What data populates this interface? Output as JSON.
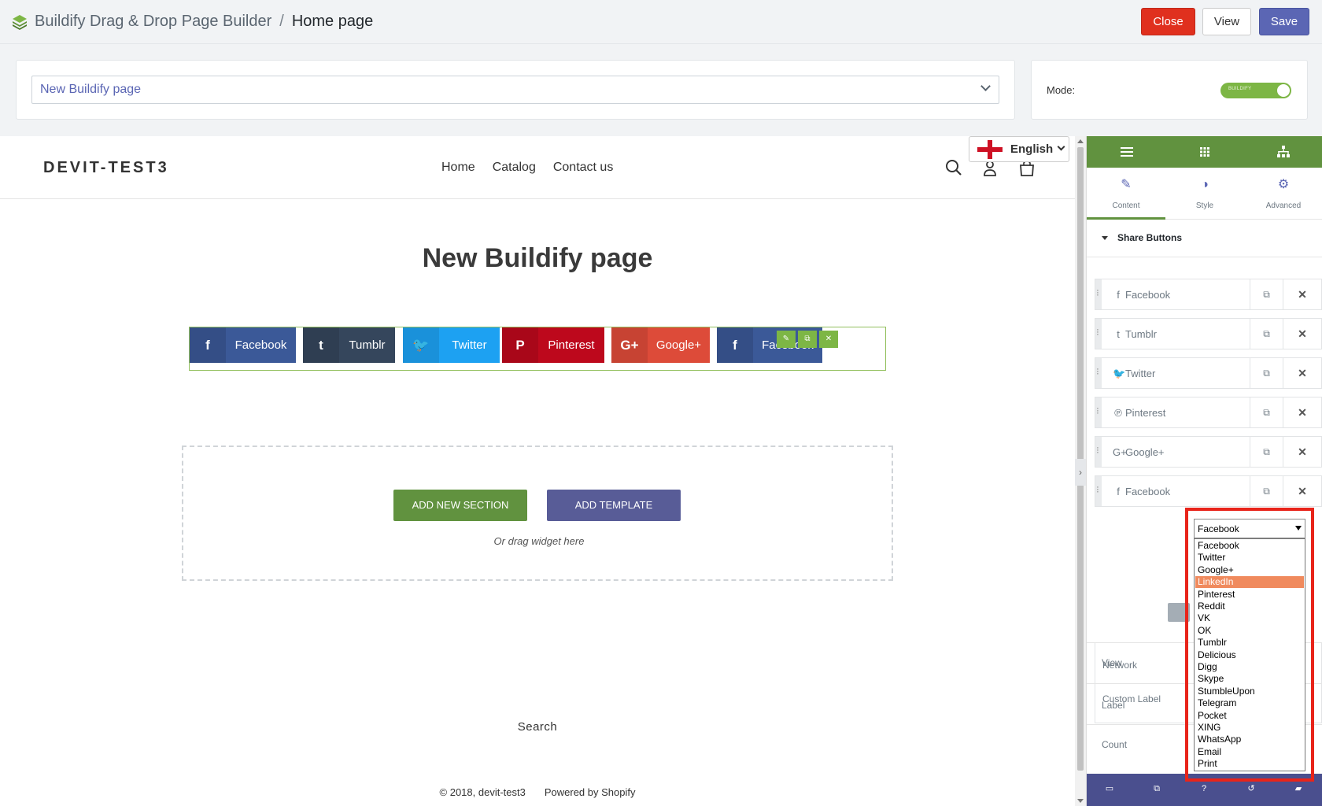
{
  "topbar": {
    "app_title": "Buildify Drag & Drop Page Builder",
    "separator": "/",
    "current_page": "Home page",
    "close_label": "Close",
    "view_label": "View",
    "save_label": "Save"
  },
  "page_select": {
    "value": "New Buildify page"
  },
  "mode": {
    "label": "Mode:",
    "toggle_text": "BUILDIFY",
    "enabled": true
  },
  "store": {
    "logo": "DEVIT-TEST3",
    "nav": [
      "Home",
      "Catalog",
      "Contact us"
    ],
    "language": "English",
    "page_title": "New Buildify page",
    "share_buttons": [
      {
        "icon": "facebook-icon",
        "glyph": "f",
        "label": "Facebook",
        "color": "#3b5998",
        "icon_bg": "#344e86"
      },
      {
        "icon": "tumblr-icon",
        "glyph": "t",
        "label": "Tumblr",
        "color": "#35465c",
        "icon_bg": "#2f3e52"
      },
      {
        "icon": "twitter-icon",
        "glyph": "🐦",
        "label": "Twitter",
        "color": "#1da1f2",
        "icon_bg": "#1a91da"
      },
      {
        "icon": "pinterest-icon",
        "glyph": "P",
        "label": "Pinterest",
        "color": "#bd081c",
        "icon_bg": "#a90719"
      },
      {
        "icon": "google-plus-icon",
        "glyph": "G+",
        "label": "Google+",
        "color": "#dd4b39",
        "icon_bg": "#c74333"
      },
      {
        "icon": "facebook-icon",
        "glyph": "f",
        "label": "Facebook",
        "color": "#3b5998",
        "icon_bg": "#344e86"
      }
    ],
    "add_section_label": "ADD NEW SECTION",
    "add_template_label": "ADD TEMPLATE",
    "drag_hint": "Or drag widget here",
    "footer_search": "Search",
    "footer_copyright": "© 2018, devit-test3",
    "footer_powered": "Powered by Shopify"
  },
  "sidebar": {
    "tabs": [
      {
        "label": "Content",
        "icon": "pencil-icon",
        "active": true
      },
      {
        "label": "Style",
        "icon": "contrast-icon",
        "active": false
      },
      {
        "label": "Advanced",
        "icon": "gear-icon",
        "active": false
      }
    ],
    "section_title": "Share Buttons",
    "items": [
      {
        "glyph": "f",
        "label": "Facebook"
      },
      {
        "glyph": "t",
        "label": "Tumblr"
      },
      {
        "glyph": "🐦",
        "label": "Twitter"
      },
      {
        "glyph": "℗",
        "label": "Pinterest"
      },
      {
        "glyph": "G+",
        "label": "Google+"
      },
      {
        "glyph": "f",
        "label": "Facebook"
      }
    ],
    "network_label": "Network",
    "custom_label": "Custom Label",
    "view_label": "View",
    "label_label": "Label",
    "count_label": "Count"
  },
  "network_select": {
    "selected": "Facebook",
    "highlighted": "LinkedIn",
    "options": [
      "Facebook",
      "Twitter",
      "Google+",
      "LinkedIn",
      "Pinterest",
      "Reddit",
      "VK",
      "OK",
      "Tumblr",
      "Delicious",
      "Digg",
      "Skype",
      "StumbleUpon",
      "Telegram",
      "Pocket",
      "XING",
      "WhatsApp",
      "Email",
      "Print"
    ]
  },
  "colors": {
    "accent_green": "#61923f",
    "accent_purple": "#5b66b4",
    "close_red": "#e0301e",
    "highlight_frame": "#e8241a"
  }
}
